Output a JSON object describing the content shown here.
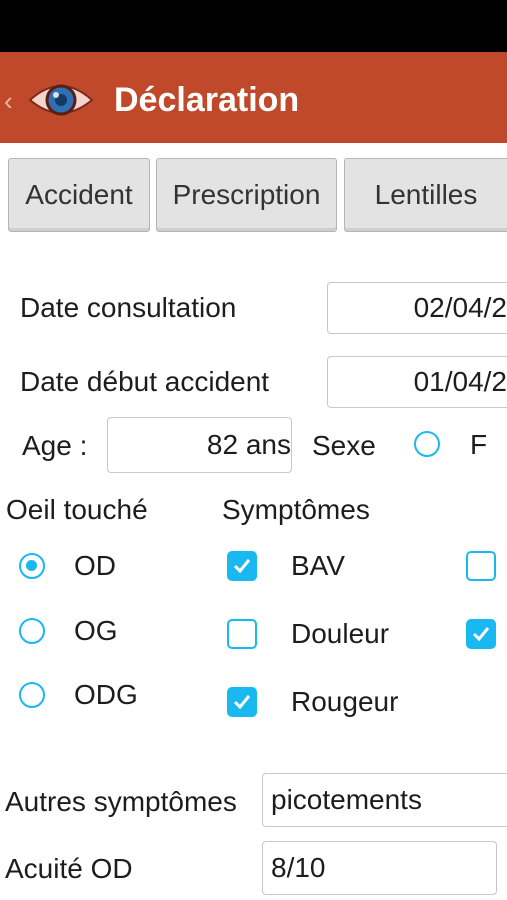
{
  "header": {
    "title": "Déclaration"
  },
  "tabs": [
    {
      "label": "Accident"
    },
    {
      "label": "Prescription"
    },
    {
      "label": "Lentilles"
    }
  ],
  "form": {
    "date_consultation": {
      "label": "Date consultation",
      "value": "02/04/2"
    },
    "date_debut_accident": {
      "label": "Date début accident",
      "value": "01/04/2"
    },
    "age": {
      "label": "Age :",
      "value": "82 ans"
    },
    "sexe": {
      "label": "Sexe",
      "option": "F",
      "selected": false
    },
    "oeil_touche": {
      "label": "Oeil touché",
      "options": [
        {
          "label": "OD",
          "selected": true
        },
        {
          "label": "OG",
          "selected": false
        },
        {
          "label": "ODG",
          "selected": false
        }
      ]
    },
    "symptomes": {
      "label": "Symptômes",
      "items": [
        {
          "label": "BAV",
          "checked": true
        },
        {
          "label": "Douleur",
          "checked": false
        },
        {
          "label": "Rougeur",
          "checked": true
        }
      ],
      "extra_checks": [
        {
          "checked": false
        },
        {
          "checked": true
        }
      ]
    },
    "autres_symptomes": {
      "label": "Autres symptômes",
      "value": "picotements"
    },
    "acuite_od": {
      "label": "Acuité OD",
      "value": "8/10"
    }
  },
  "colors": {
    "action_bar": "#c0492b",
    "accent": "#19b8f0",
    "status_bar": "#000000"
  }
}
